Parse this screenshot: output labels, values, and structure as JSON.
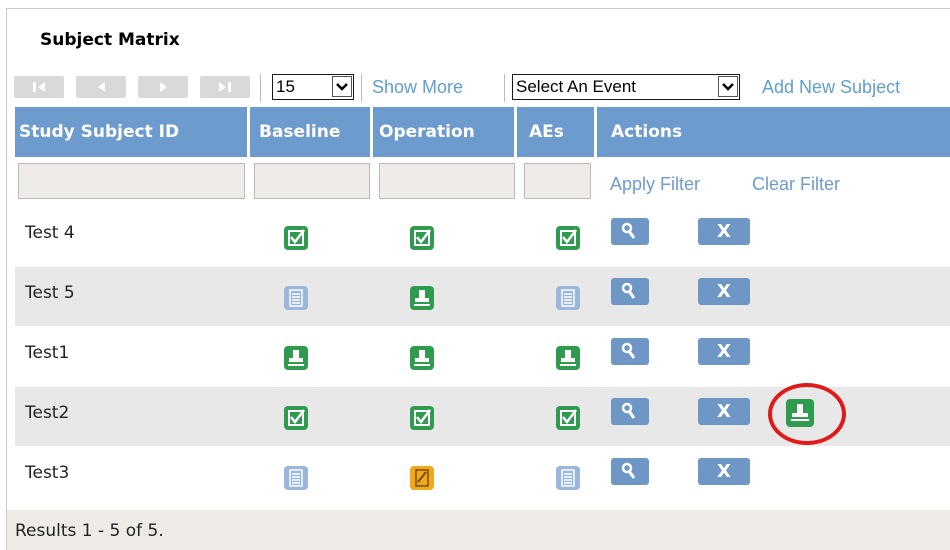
{
  "title": "Subject Matrix",
  "toolbar": {
    "nav_buttons": [
      "first-page",
      "previous-page",
      "next-page",
      "last-page"
    ],
    "page_size": "15",
    "show_more": "Show More",
    "event_select": "Select An Event",
    "add_new": "Add New Subject"
  },
  "columns": [
    "Study Subject ID",
    "Baseline",
    "Operation",
    "AEs",
    "Actions"
  ],
  "filter": {
    "apply": "Apply Filter",
    "clear": "Clear Filter"
  },
  "rows": [
    {
      "id": "Test 4",
      "baseline": "completed",
      "operation": "completed",
      "aes": "completed",
      "actions": [
        "view",
        "remove"
      ]
    },
    {
      "id": "Test 5",
      "baseline": "not-scheduled",
      "operation": "data-entry-started",
      "aes": "not-scheduled",
      "actions": [
        "view",
        "remove"
      ]
    },
    {
      "id": "Test1",
      "baseline": "data-entry-started",
      "operation": "data-entry-started",
      "aes": "data-entry-started",
      "actions": [
        "view",
        "remove"
      ]
    },
    {
      "id": "Test2",
      "baseline": "completed",
      "operation": "completed",
      "aes": "completed",
      "actions": [
        "view",
        "remove",
        "sign"
      ]
    },
    {
      "id": "Test3",
      "baseline": "not-scheduled",
      "operation": "scheduled",
      "aes": "not-scheduled",
      "actions": [
        "view",
        "remove"
      ]
    }
  ],
  "remove_label": "X",
  "footer": "Results 1 - 5 of 5.",
  "colors": {
    "header_bg": "#6d9bcd",
    "link": "#5f9fce",
    "completed": "#2e9b4e",
    "data_entry_started": "#2e9b4e",
    "not_scheduled": "#9ab7da",
    "scheduled": "#f0a81c",
    "action_button": "#6f97c5",
    "highlight_circle": "#e01a1a"
  }
}
